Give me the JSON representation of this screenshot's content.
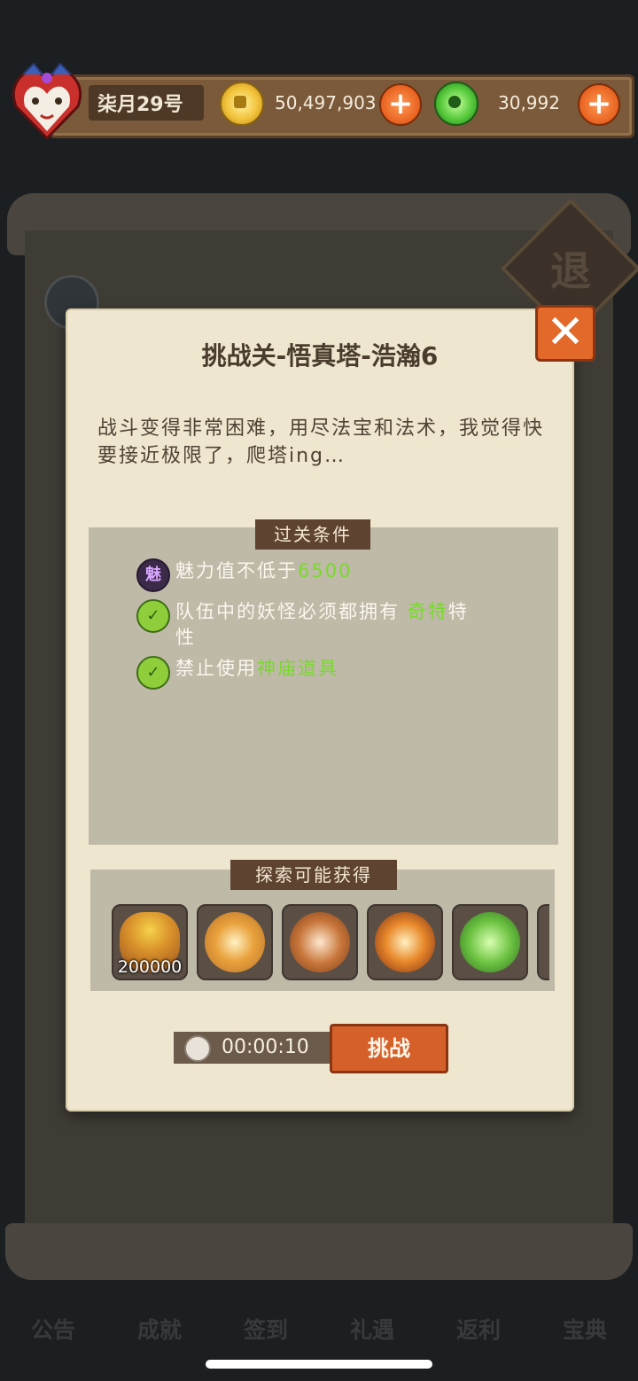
{
  "top_bar": {
    "player_name": "柒月29号",
    "coins": "50,497,903",
    "jade": "30,992",
    "coin_icon": "gold-coin-icon",
    "jade_icon": "jade-coin-icon"
  },
  "background": {
    "sign_text": "退",
    "nav_items": [
      "公告",
      "成就",
      "签到",
      "礼遇",
      "返利",
      "宝典"
    ]
  },
  "dialog": {
    "title": "挑战关-悟真塔-浩瀚6",
    "description": "战斗变得非常困难，用尽法宝和法术，我觉得快要接近极限了，爬塔ing…",
    "conditions_label": "过关条件",
    "conditions": [
      {
        "icon_text": "魅",
        "text": "魅力值不低于",
        "highlight": "6500",
        "suffix": ""
      },
      {
        "icon_text": "",
        "text": "队伍中的妖怪必须都拥有 ",
        "highlight": "奇特",
        "suffix": "特性"
      },
      {
        "icon_text": "",
        "text": "禁止使用",
        "highlight": "神庙道具",
        "suffix": ""
      }
    ],
    "rewards_label": "探索可能获得",
    "rewards": [
      {
        "icon": "gold-bag-icon",
        "count": "200000"
      },
      {
        "icon": "compass-star-icon",
        "count": ""
      },
      {
        "icon": "swirl-orb-icon",
        "count": ""
      },
      {
        "icon": "flame-orb-icon",
        "count": ""
      },
      {
        "icon": "clover-orb-icon",
        "count": ""
      }
    ],
    "timer": "00:00:10",
    "challenge_label": "挑战",
    "close_symbol": "✕"
  },
  "colors": {
    "highlight": "#7bd82f",
    "button_orange": "#d6602a",
    "panel": "#efe6cf"
  }
}
